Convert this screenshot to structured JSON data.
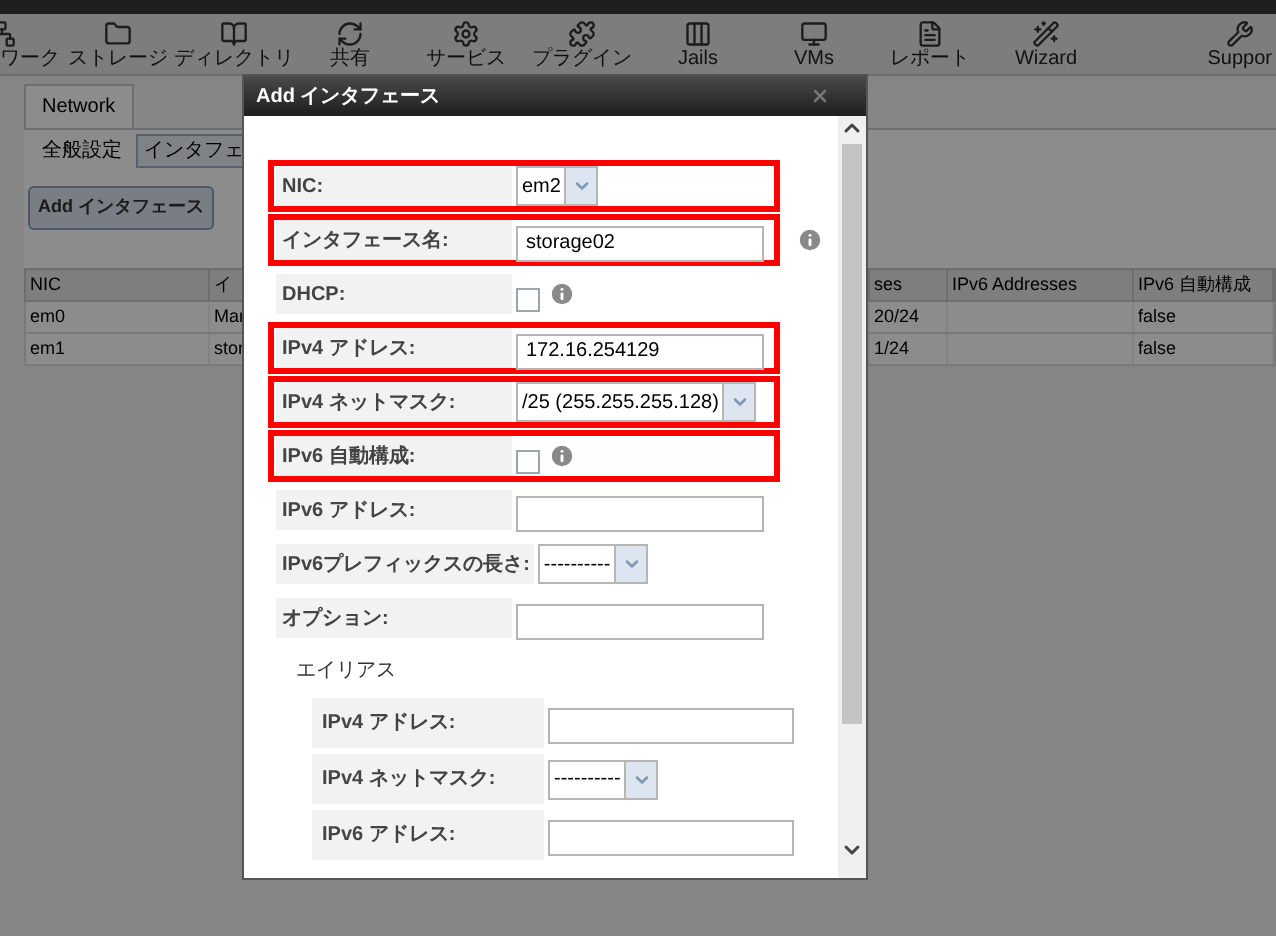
{
  "toolbar": [
    {
      "label": "ワーク"
    },
    {
      "label": "ストレージ"
    },
    {
      "label": "ディレクトリ"
    },
    {
      "label": "共有"
    },
    {
      "label": "サービス"
    },
    {
      "label": "プラグイン"
    },
    {
      "label": "Jails"
    },
    {
      "label": "VMs"
    },
    {
      "label": "レポート"
    },
    {
      "label": "Wizard"
    },
    {
      "label": "Suppor"
    }
  ],
  "tabs": [
    {
      "label": "Network",
      "selected": true
    }
  ],
  "subtabs": [
    {
      "label": "全般設定",
      "selected": false
    },
    {
      "label": "インタフェ",
      "selected": true
    }
  ],
  "add_button": "Add インタフェース",
  "table": {
    "columns": [
      "NIC",
      "イ",
      "",
      "ses",
      "IPv6 Addresses",
      "IPv6 自動構成"
    ],
    "rows": [
      [
        "em0",
        "Mar",
        "",
        "20/24",
        "",
        "false"
      ],
      [
        "em1",
        "stor",
        "",
        "1/24",
        "",
        "false"
      ]
    ]
  },
  "dialog": {
    "title": "Add インタフェース",
    "rows": [
      {
        "kind": "select",
        "label": "NIC:",
        "value": "em2",
        "highlighted": true
      },
      {
        "kind": "text",
        "label": "インタフェース名:",
        "value": "storage02",
        "info": true,
        "highlighted": true
      },
      {
        "kind": "checkbox",
        "label": "DHCP:",
        "checked": false,
        "info": true,
        "highlighted": false
      },
      {
        "kind": "text",
        "label": "IPv4 アドレス:",
        "value": "172.16.254129",
        "highlighted": true
      },
      {
        "kind": "select",
        "label": "IPv4 ネットマスク:",
        "value": "/25 (255.255.255.128)",
        "highlighted": true
      },
      {
        "kind": "checkbox",
        "label": "IPv6 自動構成:",
        "checked": false,
        "info": true,
        "highlighted": true
      },
      {
        "kind": "text",
        "label": "IPv6 アドレス:",
        "value": "",
        "highlighted": false
      },
      {
        "kind": "select",
        "label": "IPv6プレフィックスの長さ:",
        "value": "----------",
        "highlighted": false
      },
      {
        "kind": "text",
        "label": "オプション:",
        "value": "",
        "highlighted": false
      }
    ],
    "alias_heading": "エイリアス",
    "alias_rows": [
      {
        "kind": "text",
        "label": "IPv4 アドレス:",
        "value": ""
      },
      {
        "kind": "select",
        "label": "IPv4 ネットマスク:",
        "value": "----------"
      },
      {
        "kind": "text",
        "label": "IPv6 アドレス:",
        "value": ""
      }
    ]
  }
}
